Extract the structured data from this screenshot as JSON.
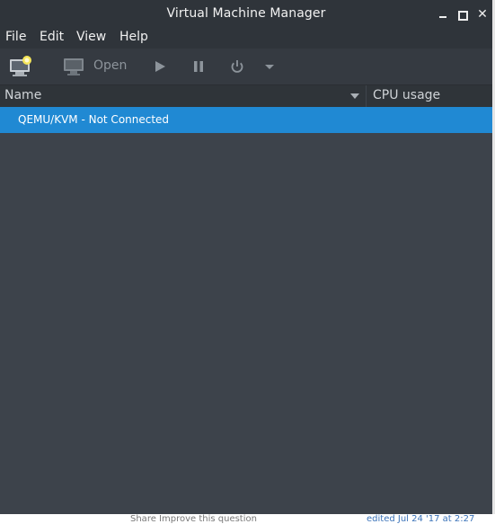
{
  "window": {
    "title": "Virtual Machine Manager"
  },
  "menubar": {
    "items": [
      "File",
      "Edit",
      "View",
      "Help"
    ]
  },
  "toolbar": {
    "new_vm_icon": "new-vm-monitor-icon",
    "open_label": "Open",
    "open_icon": "console-monitor-icon",
    "run_icon": "play-icon",
    "pause_icon": "pause-icon",
    "power_icon": "power-icon",
    "menu_icon": "dropdown-arrow-icon"
  },
  "list": {
    "columns": [
      "Name",
      "CPU usage"
    ],
    "rows": [
      {
        "name": "QEMU/KVM - Not Connected",
        "selected": true
      }
    ]
  },
  "background": {
    "bottom_left_text": "Share  Improve this question",
    "bottom_right_text": "edited Jul 24 '17 at 2:27"
  },
  "colors": {
    "selection": "#2089d3",
    "window_bg": "#3d434b",
    "titlebar_bg": "#2f343a"
  }
}
